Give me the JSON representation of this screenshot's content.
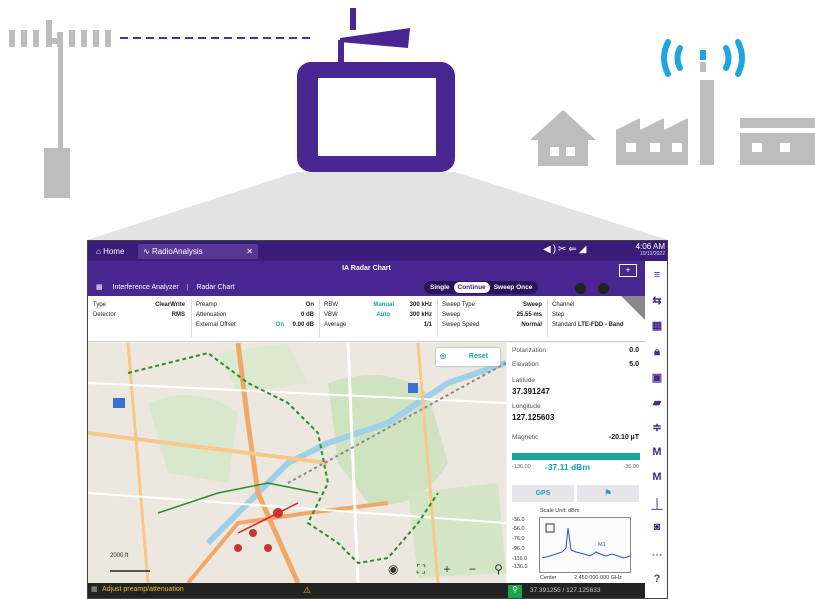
{
  "screen": {
    "tabs": [
      {
        "label": "Home"
      },
      {
        "label": "RadioAnalysis"
      }
    ],
    "clock": {
      "time": "4:06 AM",
      "date": "10/12/2022"
    },
    "title": "IA Radar Chart",
    "breadcrumb": {
      "mode": "Interference Analyzer",
      "view": "Radar Chart"
    },
    "add_label": "+",
    "sweep_modes": [
      "Single",
      "Continue",
      "Sweep Once"
    ],
    "sweep_mode_active": "Continue",
    "params": {
      "col1": [
        [
          "Type",
          "ClearWrite"
        ],
        [
          "Detector",
          "RMS"
        ]
      ],
      "col2": [
        [
          "Preamp",
          "On"
        ],
        [
          "Attenuation",
          "0 dB"
        ],
        [
          "External Offset",
          "0.00 dB"
        ]
      ],
      "col2_offset_state": "On",
      "col3": [
        [
          "RBW",
          "Manual",
          "300 kHz"
        ],
        [
          "VBW",
          "Auto",
          "300 kHz"
        ],
        [
          "Average",
          "",
          "1/1"
        ]
      ],
      "col4": [
        [
          "Sweep Type",
          "Sweep"
        ],
        [
          "Sweep",
          "25.55 ms"
        ],
        [
          "Sweep Speed",
          "Normal"
        ]
      ],
      "col5": [
        [
          "Channel",
          ""
        ],
        [
          "Step",
          ""
        ],
        [
          "Standard",
          "LTE-FDD - Band"
        ]
      ]
    },
    "map": {
      "reset_label": "Reset",
      "scale": "2000 ft"
    },
    "panel": {
      "polarization_label": "Polarization",
      "polarization_value": "0.0",
      "elevation_label": "Elevation",
      "elevation_value": "5.0",
      "latitude_label": "Latitude",
      "latitude_value": "37.391247",
      "longitude_label": "Longitude",
      "longitude_value": "127.125603",
      "magnetic_label": "Magnetic",
      "magnetic_value": "-20.10 µT",
      "bar_min": "-136.00",
      "bar_value": "-37.11 dBm",
      "bar_max": "-36.00",
      "gps_button": "GPS",
      "spectrum": {
        "scale_unit": "Scale Unit: dBm",
        "yticks": [
          "-36.0",
          "-56.0",
          "-76.0",
          "-96.0",
          "-116.0",
          "-136.0"
        ],
        "center_label": "Center",
        "center_freq": "2.450 000 000 GHz",
        "marker": "M1"
      }
    },
    "status": {
      "message": "Adjust preamp/attenuation",
      "coords": "37.391255 / 127.125633"
    },
    "colors": {
      "primary": "#4a2690",
      "accent": "#17a1b5",
      "teal_bar": "#18a79a"
    }
  },
  "illustration": {
    "icons": [
      "cell-tower-icon",
      "signal-waves-icon",
      "house-icon",
      "factory-icon",
      "store-icon",
      "handheld-analyzer-icon"
    ]
  }
}
